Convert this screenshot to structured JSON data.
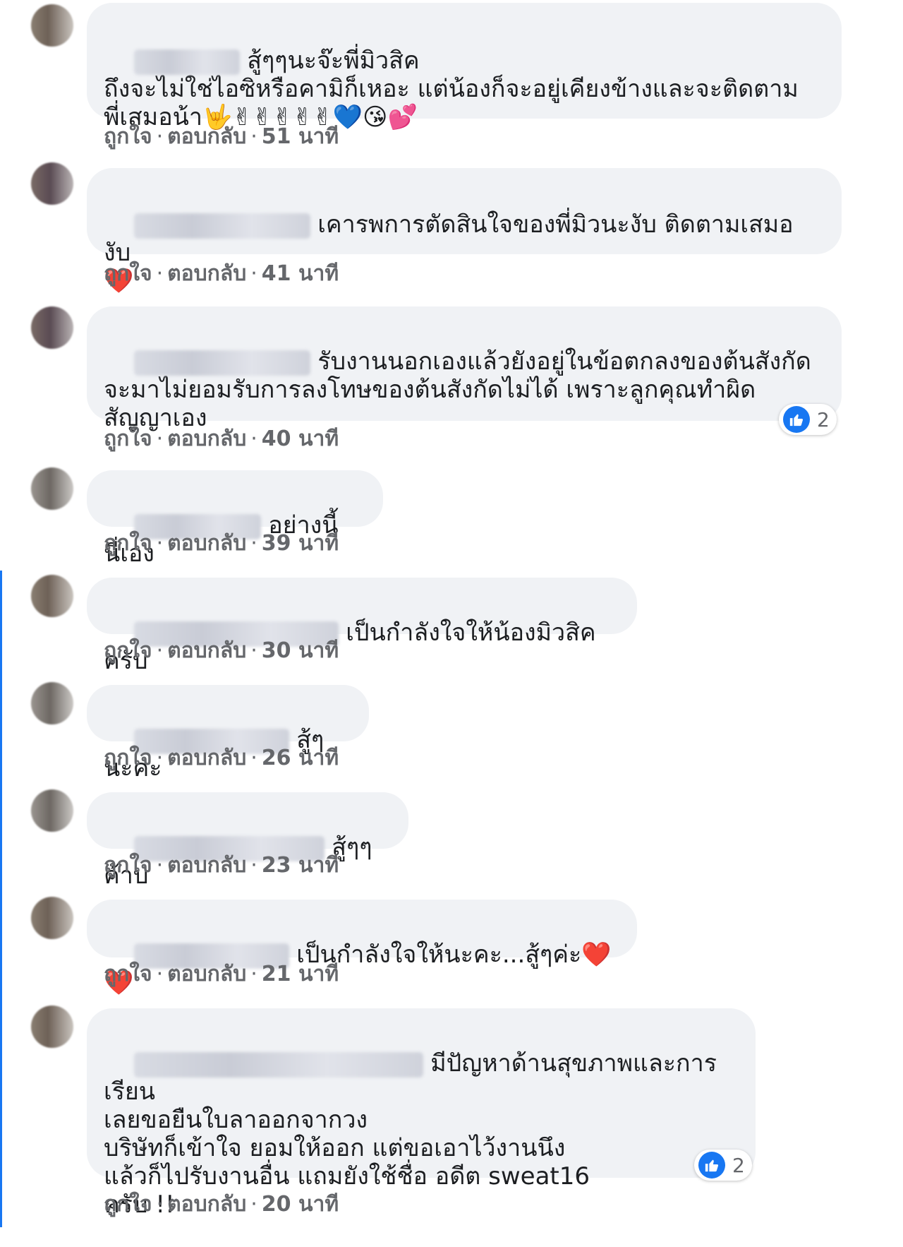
{
  "comments": [
    {
      "text": "สู้ๆๆนะจ๊ะพี่มิวสิค\nถึงจะไม่ใช่ไอซิหรือคามิก็เหอะ แต่น้องก็จะอยู่เคียงข้างและจะติดตาม\nพี่เสมอน้า🤟✌✌✌✌✌💙😘💕",
      "like": "ถูกใจ",
      "sep": "·",
      "reply": "ตอบกลับ",
      "time": "51 นาที"
    },
    {
      "text": "เคารพการตัดสินใจของพี่มิวนะงับ ติดตามเสมองับ\n❤️",
      "like": "ถูกใจ",
      "sep": "·",
      "reply": "ตอบกลับ",
      "time": "41 นาที"
    },
    {
      "text": "รับงานนอกเองแล้วยังอยู่ในข้อตกลงของต้นสังกัด\nจะมาไม่ยอมรับการลงโทษของต้นสังกัดไม่ได้ เพราะลูกคุณทำผิด\nสัญญาเอง",
      "like": "ถูกใจ",
      "sep": "·",
      "reply": "ตอบกลับ",
      "time": "40 นาที",
      "reactions": "2"
    },
    {
      "text": "อย่างนี้นี่เอง",
      "like": "ถูกใจ",
      "sep": "·",
      "reply": "ตอบกลับ",
      "time": "39 นาที"
    },
    {
      "text": "เป็นกำลังใจให้น้องมิวสิคครับ",
      "like": "ถูกใจ",
      "sep": "·",
      "reply": "ตอบกลับ",
      "time": "30 นาที"
    },
    {
      "text": "สู้ๆนะคะ",
      "like": "ถูกใจ",
      "sep": "·",
      "reply": "ตอบกลับ",
      "time": "26 นาที"
    },
    {
      "text": "สู้ๆๆค้าบ",
      "like": "ถูกใจ",
      "sep": "·",
      "reply": "ตอบกลับ",
      "time": "23 นาที"
    },
    {
      "text": "เป็นกำลังใจให้นะคะ...สู้ๆค่ะ❤️❤️",
      "like": "ถูกใจ",
      "sep": "·",
      "reply": "ตอบกลับ",
      "time": "21 นาที"
    },
    {
      "text": "มีปัญหาด้านสุขภาพและการเรียน\nเลยขอยืนใบลาออกจากวง\nบริษัทก็เข้าใจ ยอมให้ออก แต่ขอเอาไว้งานนึง\nแล้วก็ไปรับงานอื่น แถมยังใช้ชื่อ อดีต sweat16\nครับ !!",
      "like": "ถูกใจ",
      "sep": "·",
      "reply": "ตอบกลับ",
      "time": "20 นาที",
      "reactions": "2"
    }
  ],
  "colors": {
    "bubble": "#f0f2f5",
    "meta": "#65676b",
    "like_blue": "#1877f2"
  }
}
